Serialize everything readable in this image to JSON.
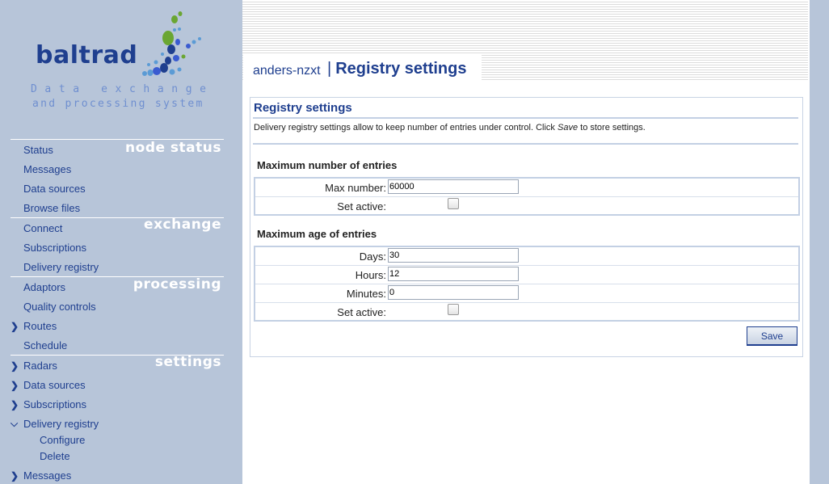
{
  "logo": {
    "wordmark": "baltrad",
    "tagline_line1": "Data exchange",
    "tagline_line2": "and processing system",
    "icon": "baltrad-dots-logo"
  },
  "sidebar": {
    "sections": {
      "node_status": "node status",
      "exchange": "exchange",
      "processing": "processing",
      "settings": "settings"
    },
    "node_status_items": [
      "Status",
      "Messages",
      "Data sources",
      "Browse files"
    ],
    "exchange_items": [
      "Connect",
      "Subscriptions",
      "Delivery registry"
    ],
    "processing_items": [
      "Adaptors",
      "Quality controls",
      "Routes",
      "Schedule"
    ],
    "settings_items": [
      "Radars",
      "Data sources",
      "Subscriptions",
      "Delivery registry"
    ],
    "delivery_registry_subitems": [
      "Configure",
      "Delete"
    ],
    "messages_item": "Messages"
  },
  "header": {
    "host": "anders-nzxt",
    "separator": "|",
    "title": "Registry settings"
  },
  "panel": {
    "title": "Registry settings",
    "description_pre": "Delivery registry settings allow to keep number of entries under control. Click ",
    "description_em": "Save",
    "description_post": " to store settings.",
    "max_number_group": {
      "title": "Maximum number of entries",
      "max_number_label": "Max number:",
      "max_number_value": "60000",
      "set_active_label": "Set active:",
      "set_active_checked": false
    },
    "max_age_group": {
      "title": "Maximum age of entries",
      "days_label": "Days:",
      "days_value": "30",
      "hours_label": "Hours:",
      "hours_value": "12",
      "minutes_label": "Minutes:",
      "minutes_value": "0",
      "set_active_label": "Set active:",
      "set_active_checked": false
    },
    "save_label": "Save"
  },
  "colors": {
    "sidebar_bg": "#b7c5d9",
    "accent_blue": "#1f3f8f",
    "logo_green": "#6aa632",
    "logo_light_blue": "#5b9bd5"
  }
}
